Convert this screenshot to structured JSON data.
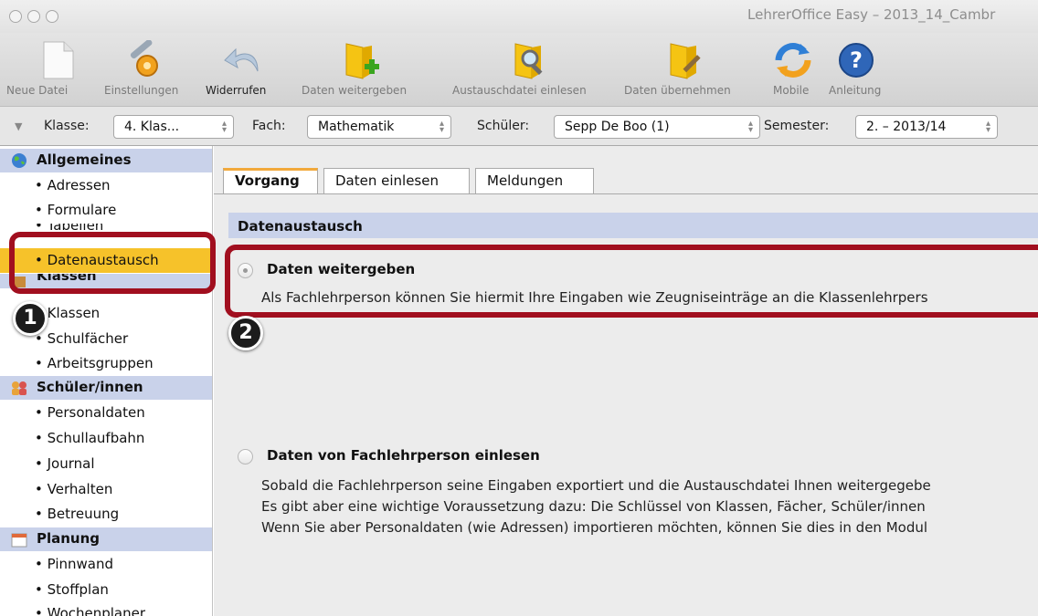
{
  "window": {
    "title": "LehrerOffice Easy – 2013_14_Cambr"
  },
  "toolbar": {
    "items": [
      {
        "label": "Neue Datei",
        "icon": "new-file-icon"
      },
      {
        "label": "Einstellungen",
        "icon": "settings-gear-icon"
      },
      {
        "label": "Widerrufen",
        "icon": "undo-icon"
      },
      {
        "label": "Daten weitergeben",
        "icon": "folder-add-icon"
      },
      {
        "label": "Austauschdatei einlesen",
        "icon": "folder-search-icon"
      },
      {
        "label": "Daten übernehmen",
        "icon": "folder-edit-icon"
      },
      {
        "label": "Mobile",
        "icon": "sync-icon"
      },
      {
        "label": "Anleitung",
        "icon": "help-icon"
      }
    ]
  },
  "selectors": {
    "klasse": {
      "label": "Klasse:",
      "value": "4. Klas..."
    },
    "fach": {
      "label": "Fach:",
      "value": "Mathematik"
    },
    "schueler": {
      "label": "Schüler:",
      "value": "Sepp De Boo (1)"
    },
    "semester": {
      "label": "Semester:",
      "value": "2. – 2013/14"
    }
  },
  "sidebar": {
    "groups": [
      {
        "header": "Allgemeines",
        "icon": "globe-icon",
        "items": [
          "• Adressen",
          "• Formulare",
          "• Tabellen",
          "• Datenaustausch"
        ]
      },
      {
        "header": "Klassen",
        "icon": "class-icon",
        "items": [
          "• Klassen",
          "• Schulfächer",
          "• Arbeitsgruppen"
        ]
      },
      {
        "header": "Schüler/innen",
        "icon": "students-icon",
        "items": [
          "• Personaldaten",
          "• Schullaufbahn",
          "• Journal",
          "• Verhalten",
          "• Betreuung"
        ]
      },
      {
        "header": "Planung",
        "icon": "calendar-icon",
        "items": [
          "• Pinnwand",
          "• Stoffplan",
          "• Wochenplaner"
        ]
      }
    ],
    "selected": "• Datenaustausch"
  },
  "tabs": [
    "Vorgang",
    "Daten einlesen",
    "Meldungen"
  ],
  "section": {
    "title": "Datenaustausch"
  },
  "options": [
    {
      "title": "Daten weitergeben",
      "selected": true,
      "lines": [
        "Als Fachlehrperson können Sie hiermit Ihre Eingaben wie Zeugniseinträge an die Klassenlehrpers"
      ]
    },
    {
      "title": "Daten von Fachlehrperson einlesen",
      "selected": false,
      "lines": [
        "Sobald die Fachlehrperson seine Eingaben exportiert und die Austauschdatei Ihnen weitergegebe",
        "Es gibt aber eine wichtige Voraussetzung dazu: Die Schlüssel von Klassen, Fächer, Schüler/innen",
        "Wenn Sie aber Personaldaten (wie Adressen) importieren möchten, können Sie dies in den Modul"
      ]
    }
  ],
  "annotations": {
    "callout1": "1",
    "callout2": "2"
  },
  "colors": {
    "accent": "#f6c22a",
    "header_blue": "#c9d2ea",
    "callout_red": "#a10f1f"
  }
}
